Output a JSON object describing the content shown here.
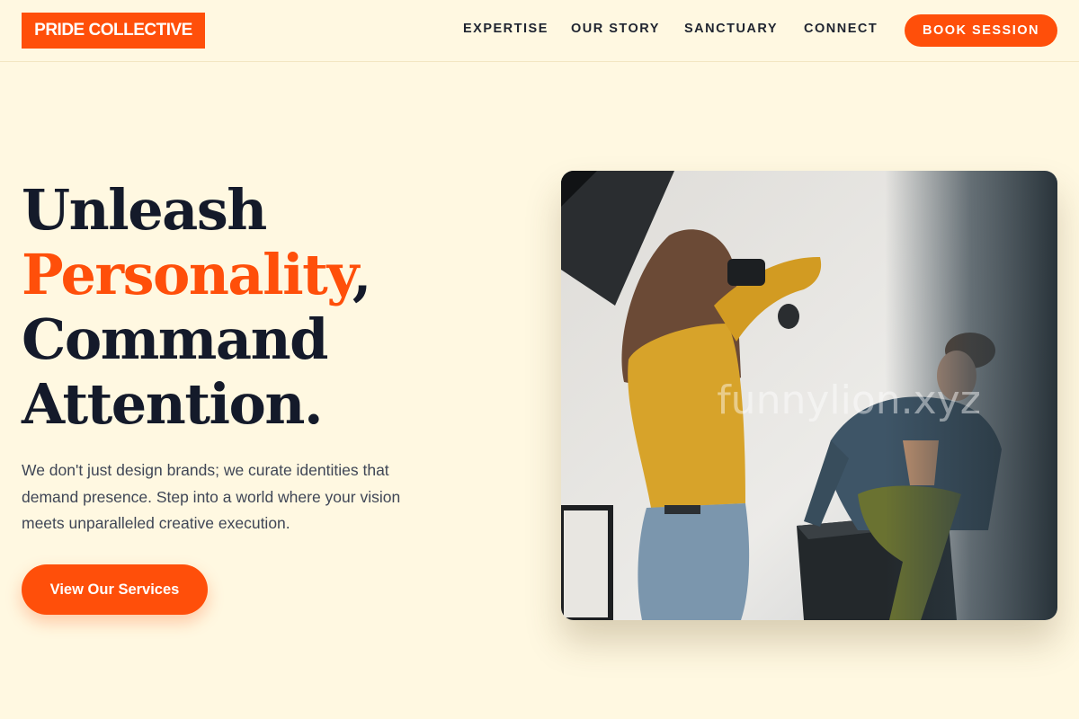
{
  "header": {
    "logo": "PRIDE COLLECTIVE",
    "nav": [
      {
        "label": "EXPERTISE"
      },
      {
        "label": "OUR STORY"
      },
      {
        "label": "SANCTUARY"
      },
      {
        "label": "CONNECT"
      }
    ],
    "cta_label": "BOOK SESSION"
  },
  "hero": {
    "headline": {
      "line1": "Unleash",
      "line2_accent": "Personality",
      "line2_suffix": ",",
      "line3": "Command",
      "line4": "Attention."
    },
    "subtext": "We don't just design brands; we curate identities that demand presence. Step into a world where your vision meets unparalleled creative execution.",
    "cta_label": "View Our Services",
    "image": {
      "watermark": "funnylion.xyz"
    }
  },
  "colors": {
    "background": "#fff8e1",
    "accent": "#ff4f0a",
    "heading": "#141a2a",
    "body_text": "#3f4656"
  }
}
